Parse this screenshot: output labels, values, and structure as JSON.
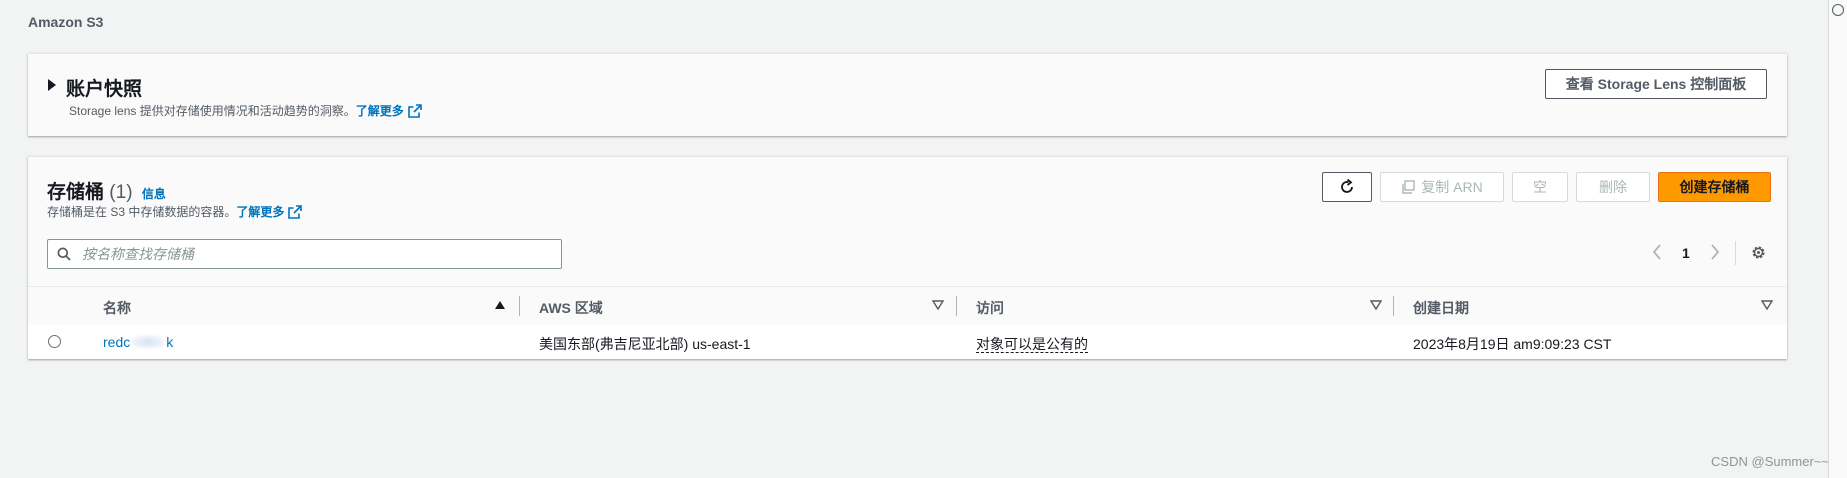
{
  "breadcrumb": "Amazon S3",
  "snapshot": {
    "title": "账户快照",
    "description": "Storage lens 提供对存储使用情况和活动趋势的洞察。",
    "learn_more": "了解更多",
    "storage_lens_button": "查看 Storage Lens 控制面板"
  },
  "buckets": {
    "title": "存储桶",
    "count": "(1)",
    "info_link": "信息",
    "description": "存储桶是在 S3 中存储数据的容器。",
    "learn_more": "了解更多",
    "buttons": {
      "copy_arn": "复制 ARN",
      "empty": "空",
      "delete": "删除",
      "create": "创建存储桶"
    },
    "search_placeholder": "按名称查找存储桶",
    "page_number": "1",
    "columns": [
      "名称",
      "AWS 区域",
      "访问",
      "创建日期"
    ],
    "rows": [
      {
        "name_prefix": "redc",
        "name_suffix": "k",
        "region": "美国东部(弗吉尼亚北部) us-east-1",
        "access": "对象可以是公有的",
        "created": "2023年8月19日 am9:09:23 CST"
      }
    ]
  },
  "watermark": "CSDN @Summer~~",
  "colors": {
    "primary": "#ff9900",
    "link": "#0073bb",
    "background": "#f2f3f3"
  },
  "icons": [
    "triangle-right-icon",
    "external-link-icon",
    "refresh-icon",
    "copy-icon",
    "search-icon",
    "chevron-left-icon",
    "chevron-right-icon",
    "settings-gear-icon",
    "sort-up-icon",
    "sort-down-icon"
  ]
}
